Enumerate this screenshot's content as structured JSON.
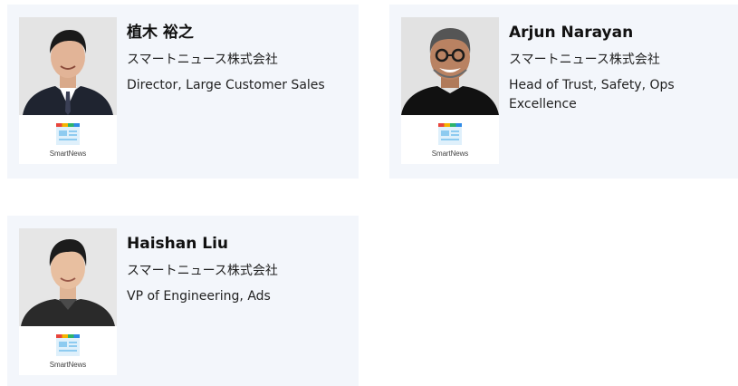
{
  "people": [
    {
      "name": "植木 裕之",
      "company": "スマートニュース株式会社",
      "title": "Director, Large Customer Sales",
      "logo_label": "SmartNews"
    },
    {
      "name": "Arjun Narayan",
      "company": "スマートニュース株式会社",
      "title": "Head of Trust, Safety, Ops Excellence",
      "logo_label": "SmartNews"
    },
    {
      "name": "Haishan Liu",
      "company": "スマートニュース株式会社",
      "title": "VP of Engineering, Ads",
      "logo_label": "SmartNews"
    }
  ],
  "colors": {
    "card_bg": "#f3f6fb",
    "logo_red": "#e8453c",
    "logo_yellow": "#f5b400",
    "logo_green": "#2db46a",
    "logo_blue": "#2f8ae6"
  }
}
